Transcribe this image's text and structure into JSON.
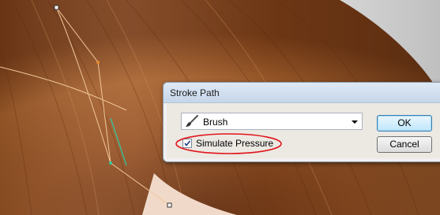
{
  "dialog": {
    "title": "Stroke Path",
    "tool": {
      "selected": "Brush",
      "icon": "brush-icon"
    },
    "simulate_pressure": {
      "label": "Simulate Pressure",
      "checked": true
    },
    "buttons": {
      "ok": "OK",
      "cancel": "Cancel"
    }
  },
  "colors": {
    "hair": "#8b4a1f",
    "path_line": "#f2c79a",
    "highlight_ellipse": "#e0141a",
    "selected_segment": "#30c8a0"
  }
}
